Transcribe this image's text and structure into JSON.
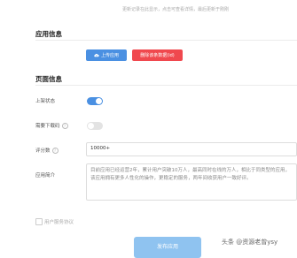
{
  "top_note": "更新记录在此显示，点击可查看详情，最后更新于刚刚",
  "app_info": {
    "title": "应用信息",
    "upload_label": "上传应用",
    "delete_label": "删除该条数据(id)"
  },
  "page_info": {
    "title": "页面信息",
    "listing_status_label": "上架状态",
    "listing_status_on": true,
    "need_download_label": "需要下载码",
    "need_download_on": false,
    "rating_label": "评分数",
    "rating_value": "10000+",
    "intro_label": "应用简介",
    "intro_text": "目前应用已经运营2年，累计用户突破10万人，最高同时在线的万人，相比于同类型的应用，该应用拥有更多人性化的操作，更稳定的服务，两年间收获用户一致好评。"
  },
  "agreement_label": "用户服务协议",
  "publish_label": "发布应用",
  "watermark": "头条 @资源老曾ysy",
  "colors": {
    "primary": "#4a90e2",
    "danger": "#f0484e",
    "publish": "#8fc3f0"
  }
}
